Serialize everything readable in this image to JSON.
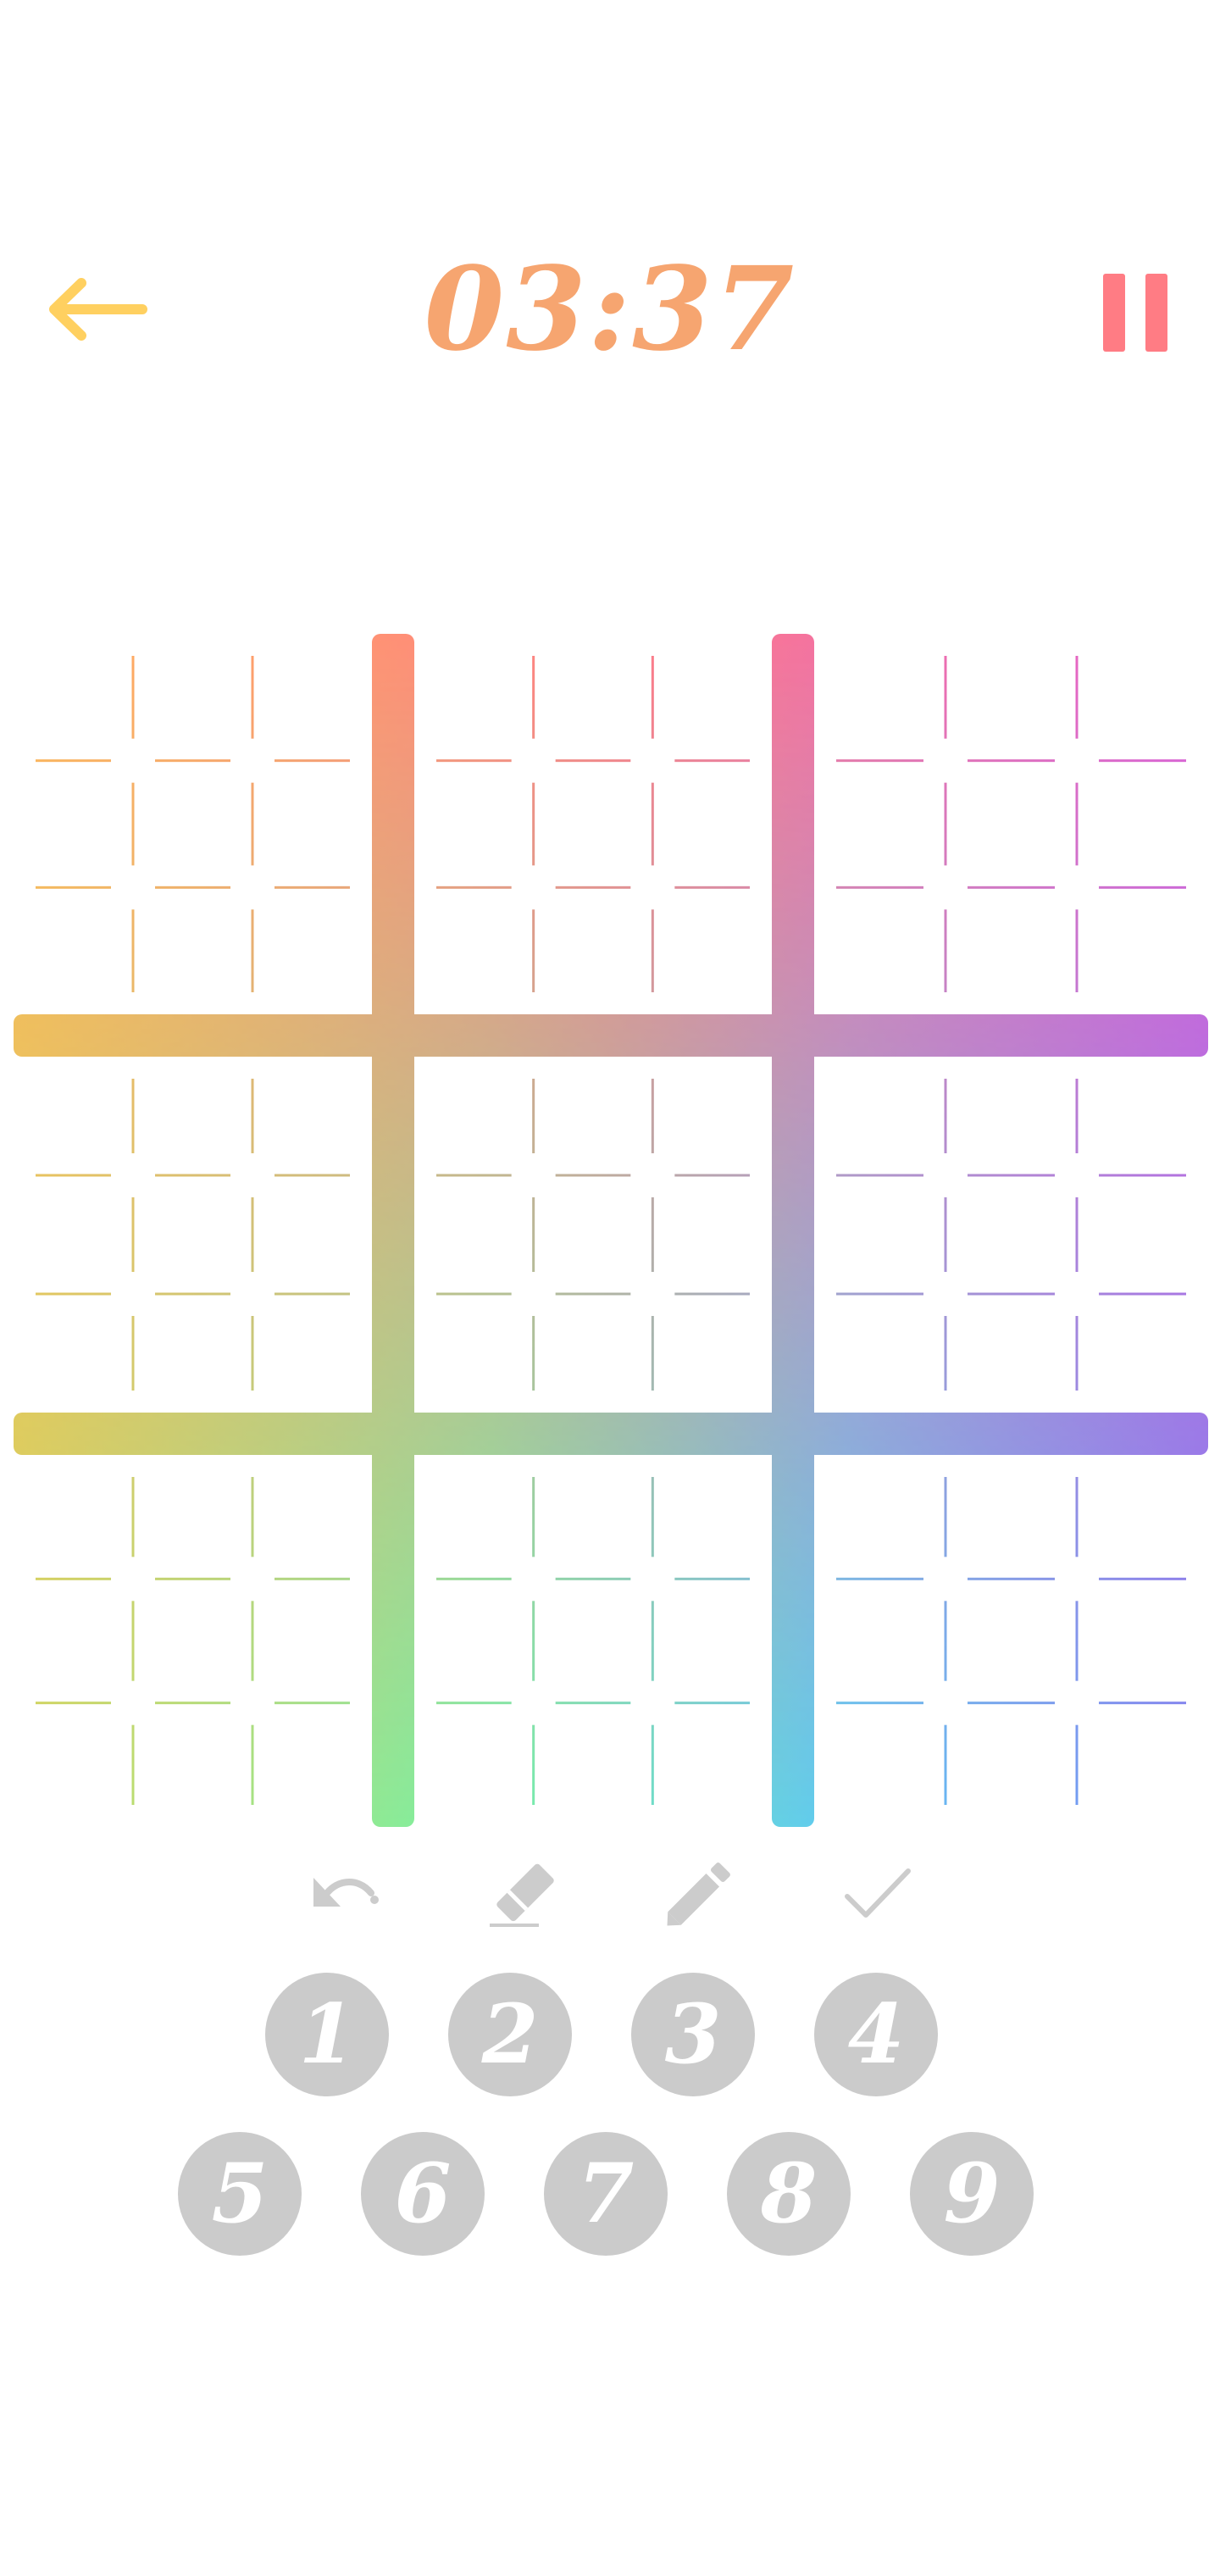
{
  "header": {
    "back_icon": "arrow-left-icon",
    "timer": "03:37",
    "pause_icon": "pause-icon",
    "colors": {
      "back": "#ffd060",
      "timer": "#f6a570",
      "pause": "#ff7c84"
    }
  },
  "board": {
    "size": 9,
    "box_size": 3,
    "cells": [
      [
        "",
        "",
        "",
        "",
        "",
        "",
        "",
        "",
        ""
      ],
      [
        "",
        "",
        "",
        "",
        "",
        "",
        "",
        "",
        ""
      ],
      [
        "",
        "",
        "",
        "",
        "",
        "",
        "",
        "",
        ""
      ],
      [
        "",
        "",
        "",
        "",
        "",
        "",
        "",
        "",
        ""
      ],
      [
        "",
        "",
        "",
        "",
        "",
        "",
        "",
        "",
        ""
      ],
      [
        "",
        "",
        "",
        "",
        "",
        "",
        "",
        "",
        ""
      ],
      [
        "",
        "",
        "",
        "",
        "",
        "",
        "",
        "",
        ""
      ],
      [
        "",
        "",
        "",
        "",
        "",
        "",
        "",
        "",
        ""
      ],
      [
        "",
        "",
        "",
        "",
        "",
        "",
        "",
        "",
        ""
      ]
    ],
    "gradient_colors": [
      "#ffb35c",
      "#ff7c84",
      "#e25fd2",
      "#b064ff",
      "#5fc9f4",
      "#7af0a6",
      "#cfd860"
    ]
  },
  "toolbar": {
    "tools": [
      {
        "name": "undo",
        "icon": "undo-icon"
      },
      {
        "name": "erase",
        "icon": "eraser-icon"
      },
      {
        "name": "notes",
        "icon": "pencil-icon"
      },
      {
        "name": "check",
        "icon": "check-icon"
      }
    ],
    "color": "#cccccc"
  },
  "numpad": {
    "row1": [
      "1",
      "2",
      "3",
      "4"
    ],
    "row2": [
      "5",
      "6",
      "7",
      "8",
      "9"
    ],
    "button_color": "#cbcbcb",
    "text_color": "#ffffff"
  }
}
